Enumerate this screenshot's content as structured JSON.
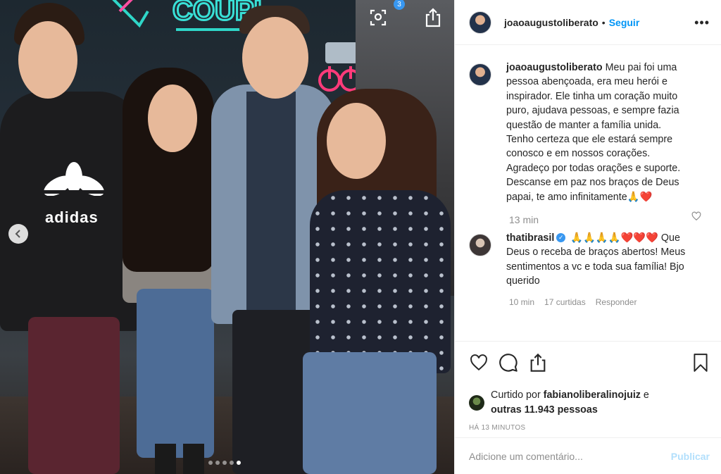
{
  "photo": {
    "carousel_count": "3",
    "tshirt_text": "adidas",
    "dots": [
      false,
      false,
      false,
      false,
      true
    ],
    "icons": {
      "tag": "tag-people-icon",
      "share": "share-icon",
      "prev": "chevron-left-icon"
    }
  },
  "header": {
    "username": "joaoaugustoliberato",
    "separator": "•",
    "follow_label": "Seguir",
    "more_label": "•••"
  },
  "caption": {
    "username": "joaoaugustoliberato",
    "text": "Meu pai foi uma pessoa abençoada, era meu herói e inspirador. Ele tinha um coração muito puro, ajudava pessoas, e sempre fazia questão de manter a família unida. Tenho certeza que ele estará sempre conosco e em nossos corações. Agradeço por todas orações e suporte.",
    "text2": "Descanse em paz nos braços de Deus papai, te amo infinitamente🙏❤️",
    "time": "13 min"
  },
  "comment": {
    "username": "thatibrasil",
    "text": "🙏🙏🙏🙏❤️❤️❤️ Que Deus o receba de braços abertos! Meus sentimentos a vc e toda sua família! Bjo querido",
    "time": "10 min",
    "likes": "17 curtidas",
    "reply": "Responder"
  },
  "actions": {
    "liked_by_prefix": "Curtido por",
    "liked_by_user": "fabianoliberalinojuiz",
    "liked_by_and": "e",
    "others": "outras 11.943 pessoas",
    "timestamp": "HÁ 13 MINUTOS"
  },
  "add_comment": {
    "placeholder": "Adicione um comentário...",
    "publish_label": "Publicar"
  },
  "colors": {
    "accent": "#0095f6",
    "publish_disabled": "#b2dffc",
    "muted": "#8e8e8e",
    "text": "#262626",
    "heart_red": "#ed4956"
  }
}
